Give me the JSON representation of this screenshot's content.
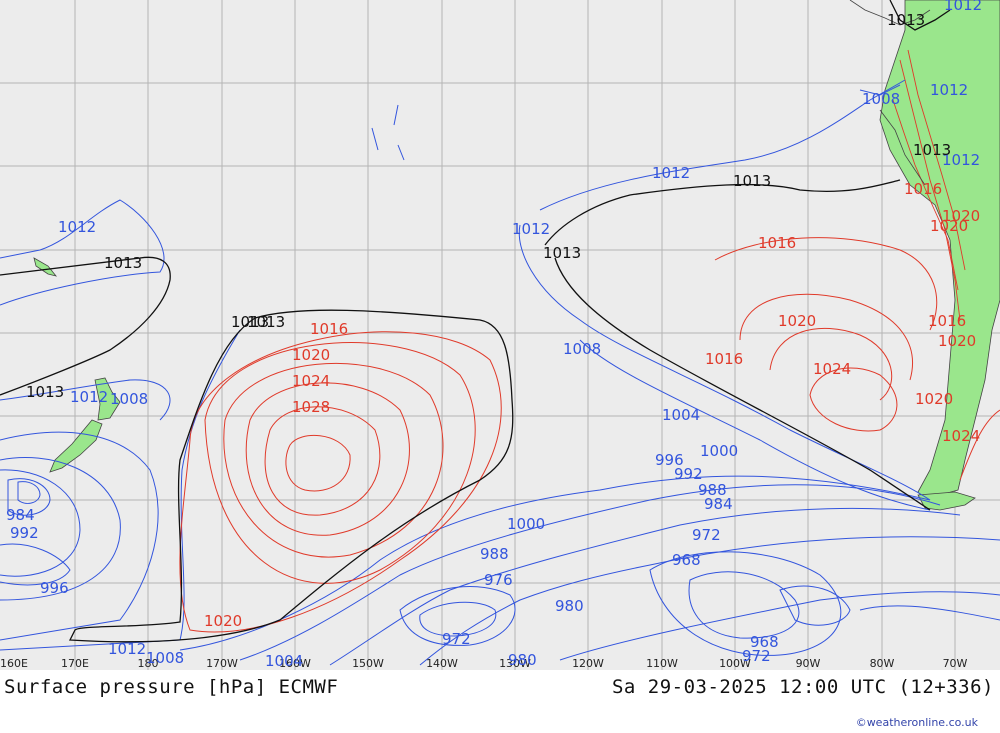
{
  "title_left": "Surface pressure [hPa] ECMWF",
  "title_right": "Sa 29-03-2025 12:00 UTC (12+336)",
  "credit": "©weatheronline.co.uk",
  "colors": {
    "ocean": "#ececec",
    "land": "#9ae68c",
    "grid": "#b4b4b4",
    "low": "#3355dd",
    "high": "#e03a2a",
    "standard": "#111111"
  },
  "longitudes": [
    "160E",
    "170E",
    "180",
    "170W",
    "160W",
    "150W",
    "140W",
    "130W",
    "120W",
    "110W",
    "100W",
    "90W",
    "80W",
    "70W"
  ],
  "isobar_labels": {
    "blue": [
      "1012",
      "1012",
      "1012",
      "1012",
      "1012",
      "1012",
      "1008",
      "1008",
      "1008",
      "1004",
      "1004",
      "1000",
      "1000",
      "996",
      "996",
      "992",
      "992",
      "988",
      "988",
      "984",
      "980",
      "980",
      "976",
      "972",
      "972",
      "972",
      "968",
      "968",
      "984",
      "1012",
      "1012",
      "1008"
    ],
    "red": [
      "1016",
      "1020",
      "1024",
      "1028",
      "1020",
      "1016",
      "1020",
      "1016",
      "1024",
      "1016",
      "1020",
      "1020",
      "1024",
      "1016",
      "1020",
      "1020"
    ],
    "black": [
      "1013",
      "1013",
      "1013",
      "1013",
      "1013",
      "1013",
      "1013",
      "1013"
    ]
  }
}
